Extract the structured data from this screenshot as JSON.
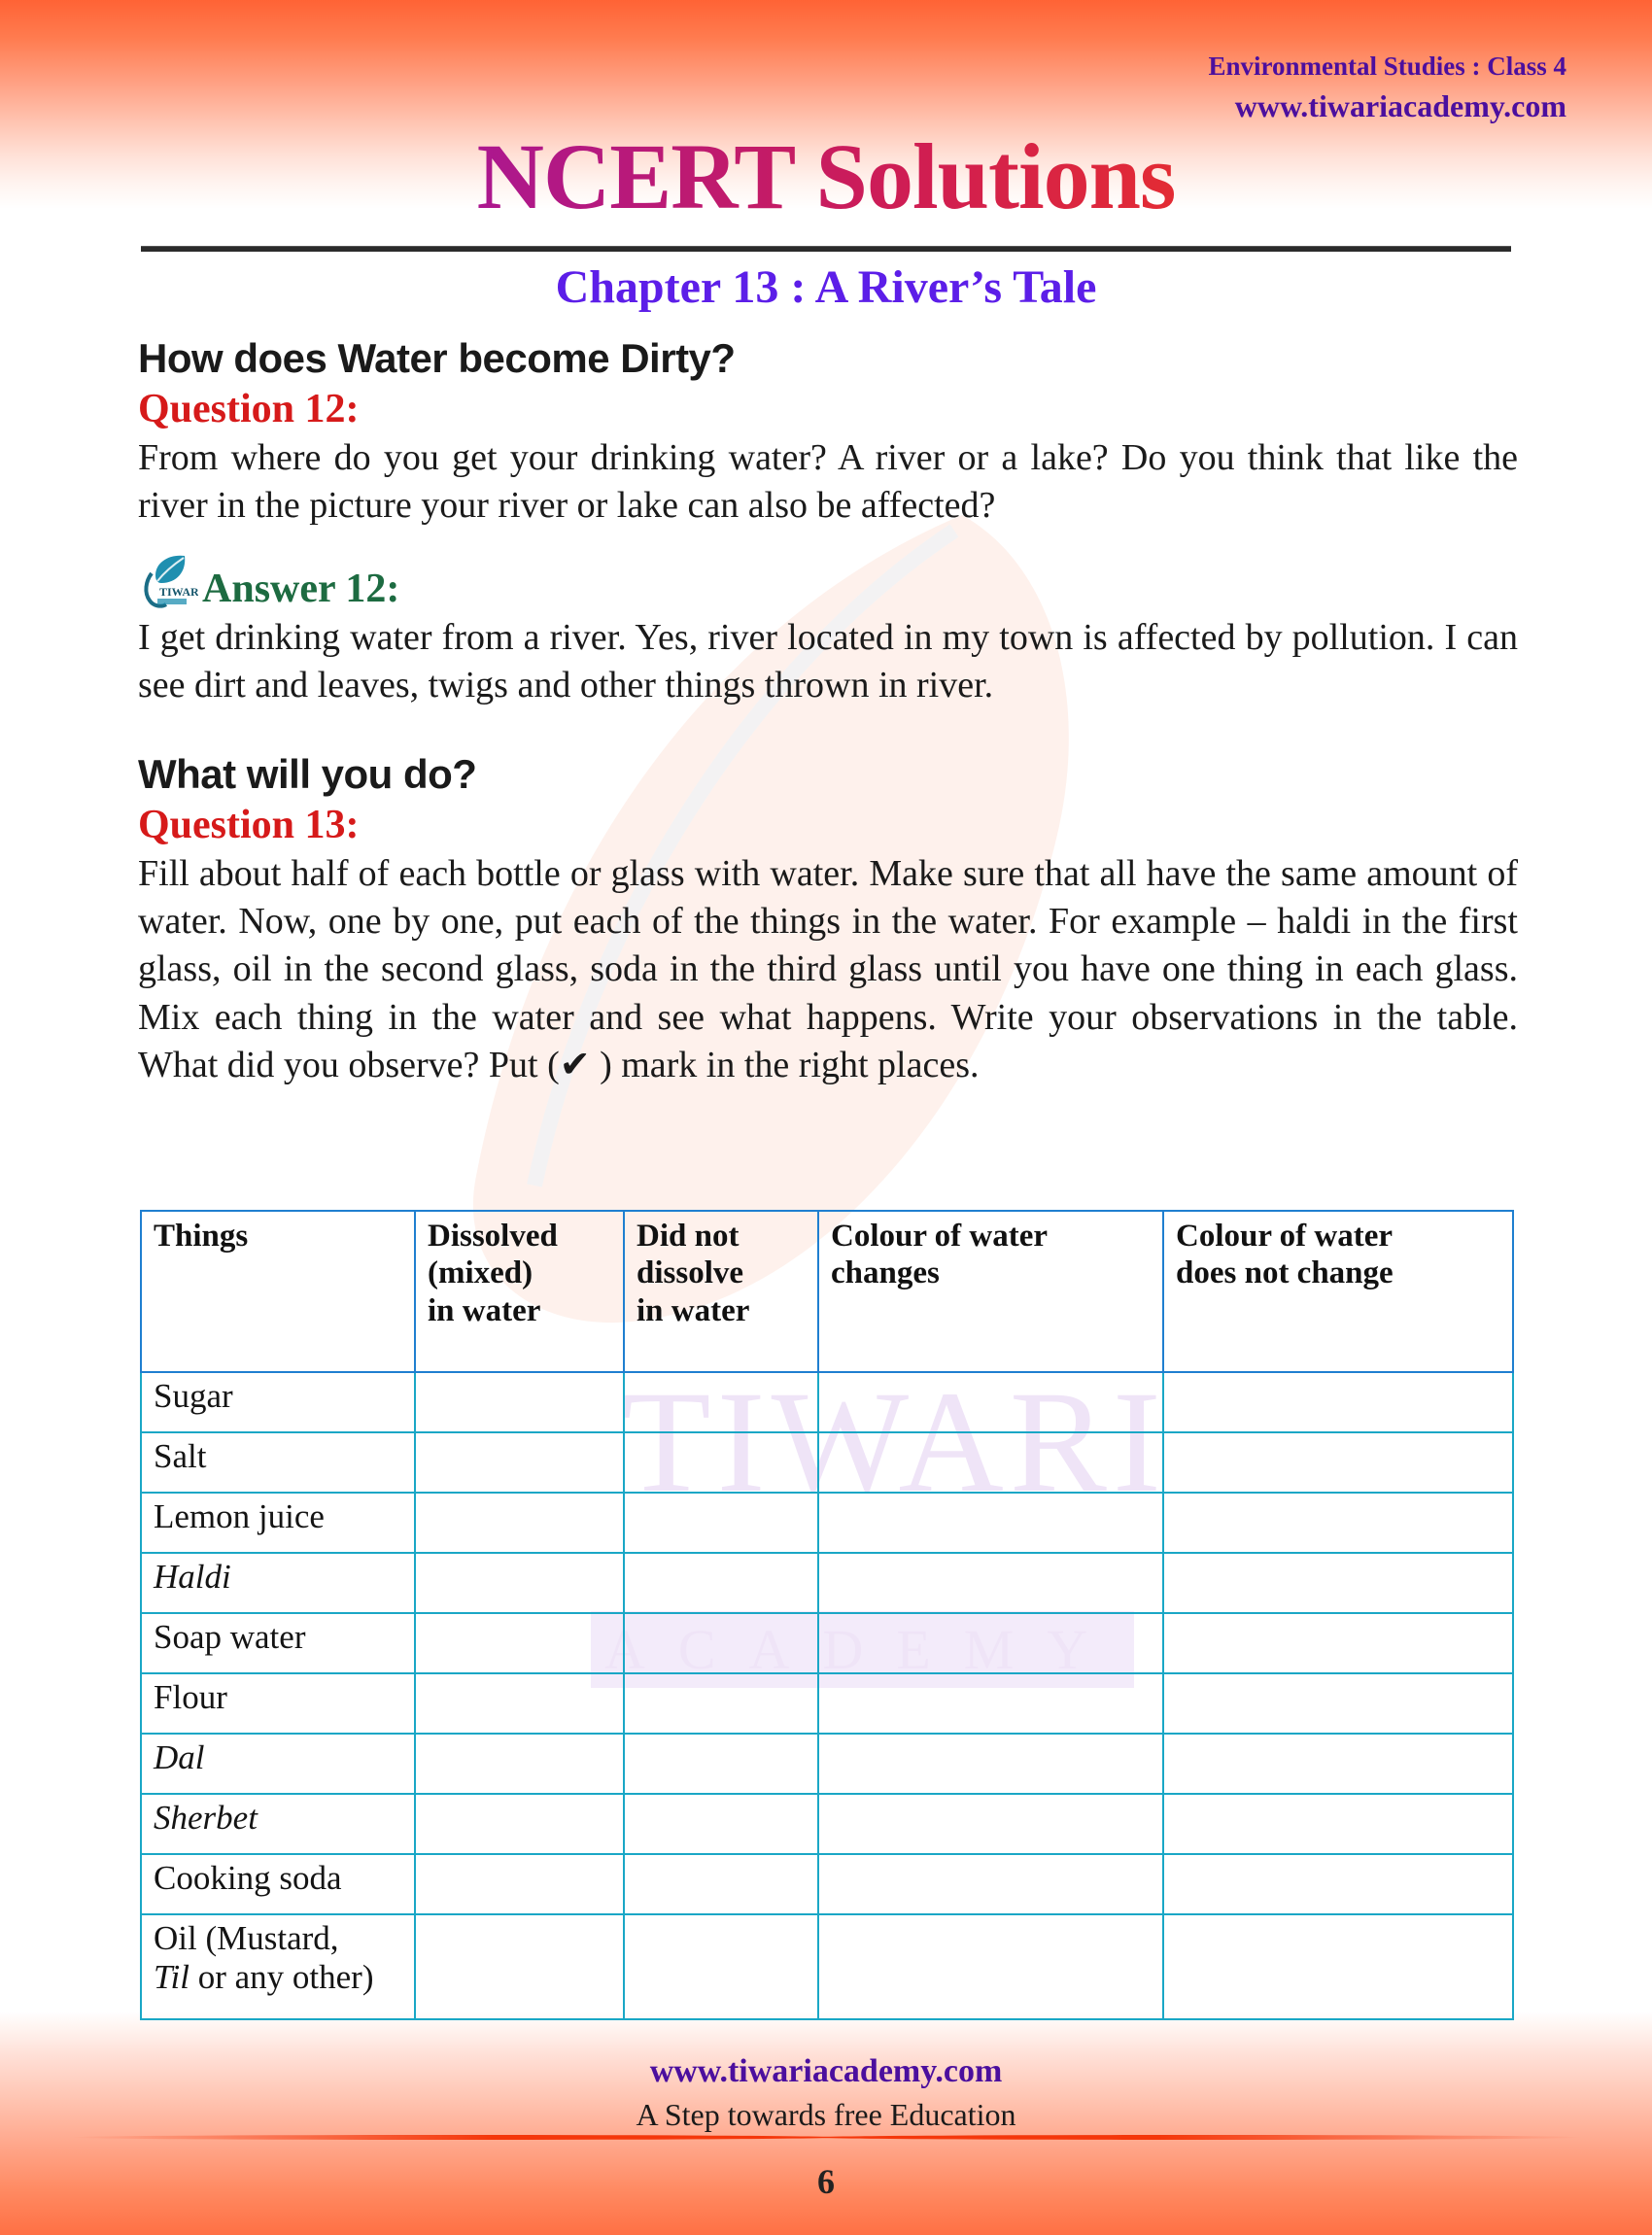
{
  "header": {
    "subject": "Environmental Studies : Class 4",
    "website": "www.tiwariacademy.com"
  },
  "title": {
    "main": "NCERT Solutions",
    "chapter": "Chapter 13 : A River’s Tale"
  },
  "sections": [
    {
      "heading": "How does Water become Dirty?",
      "question_label": "Question 12:",
      "question_text": "From where do you get your drinking water? A river or a lake? Do you think that like the river in the picture your river or lake can also be affected?",
      "answer_label": "Answer  12:",
      "answer_text": "I get drinking water from a river. Yes, river located in my town is affected by pollution. I can see dirt and leaves, twigs and other things thrown in river."
    },
    {
      "heading": "What will you do?",
      "question_label": "Question 13:",
      "question_text": "Fill about half of each bottle or glass with water. Make sure that all have the same amount of water. Now, one by one, put each of the things in the water. For example – haldi in the first glass, oil in the second glass, soda in the third glass until you have one thing in each glass. Mix each thing in the water and see what happens. Write your observations in the table. What did you observe? Put (✔ ) mark in the right places."
    }
  ],
  "table": {
    "columns": [
      "Things",
      "Dissolved (mixed) in water",
      "Did not dissolve in water",
      "Colour of water changes",
      "Colour of water does not change"
    ],
    "column_lines": [
      [
        "Things"
      ],
      [
        "Dissolved",
        "(mixed)",
        "in water"
      ],
      [
        "Did not",
        "dissolve",
        "in water"
      ],
      [
        "Colour of water",
        "changes"
      ],
      [
        "Colour of water",
        "does not change"
      ]
    ],
    "rows": [
      {
        "thing": "Sugar",
        "italic": false,
        "c1": "",
        "c2": "",
        "c3": "",
        "c4": ""
      },
      {
        "thing": "Salt",
        "italic": false,
        "c1": "",
        "c2": "",
        "c3": "",
        "c4": ""
      },
      {
        "thing": "Lemon juice",
        "italic": false,
        "c1": "",
        "c2": "",
        "c3": "",
        "c4": ""
      },
      {
        "thing": "Haldi",
        "italic": true,
        "c1": "",
        "c2": "",
        "c3": "",
        "c4": ""
      },
      {
        "thing": "Soap water",
        "italic": false,
        "c1": "",
        "c2": "",
        "c3": "",
        "c4": ""
      },
      {
        "thing": "Flour",
        "italic": false,
        "c1": "",
        "c2": "",
        "c3": "",
        "c4": ""
      },
      {
        "thing": "Dal",
        "italic": true,
        "c1": "",
        "c2": "",
        "c3": "",
        "c4": ""
      },
      {
        "thing": "Sherbet",
        "italic": true,
        "c1": "",
        "c2": "",
        "c3": "",
        "c4": ""
      },
      {
        "thing": "Cooking soda",
        "italic": false,
        "c1": "",
        "c2": "",
        "c3": "",
        "c4": ""
      }
    ],
    "last_row": {
      "line1": "Oil (Mustard,",
      "line2_italic": "Til",
      "line2_rest": " or any other)"
    }
  },
  "watermark": {
    "big": "TIWARI",
    "small": "ACADEMY",
    "logo_text": "TIWARI"
  },
  "footer": {
    "website": "www.tiwariacademy.com",
    "tagline": "A Step towards free Education",
    "page_number": "6"
  },
  "colors": {
    "accent_purple": "#4b0f9e",
    "chapter_purple": "#5c1ee8",
    "question_red": "#d61a1a",
    "answer_green": "#1d6b41",
    "table_border": "#1aa7c6",
    "table_header_border": "#1f7fd0",
    "band_orange": "#ff6335",
    "watermark_lavender": "#efe4f7"
  }
}
